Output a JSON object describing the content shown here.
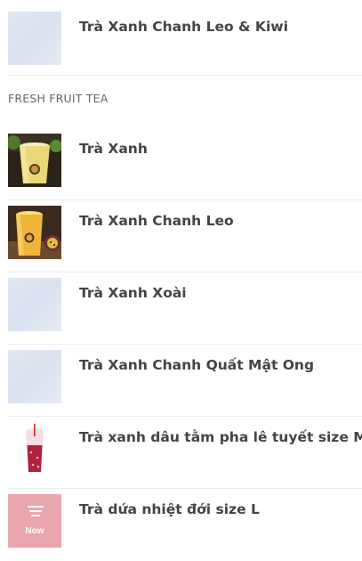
{
  "menu": {
    "top_item": {
      "name": "Trà Xanh Chanh Leo & Kiwi",
      "thumb": "placeholder"
    },
    "section": {
      "title": "FRESH FRUIT TEA",
      "items": [
        {
          "name": "Trà Xanh",
          "thumb": "photo-green-tea"
        },
        {
          "name": "Trà Xanh Chanh Leo",
          "thumb": "photo-passionfruit-tea"
        },
        {
          "name": "Trà Xanh Xoài",
          "thumb": "placeholder"
        },
        {
          "name": "Trà Xanh Chanh Quất Mật Ong",
          "thumb": "placeholder"
        },
        {
          "name": "Trà xanh dâu tằm pha lê tuyết size M",
          "thumb": "photo-mulberry-tea"
        },
        {
          "name": "Trà dứa nhiệt đới size L",
          "thumb": "now-logo",
          "thumb_text": "Now"
        }
      ]
    }
  }
}
